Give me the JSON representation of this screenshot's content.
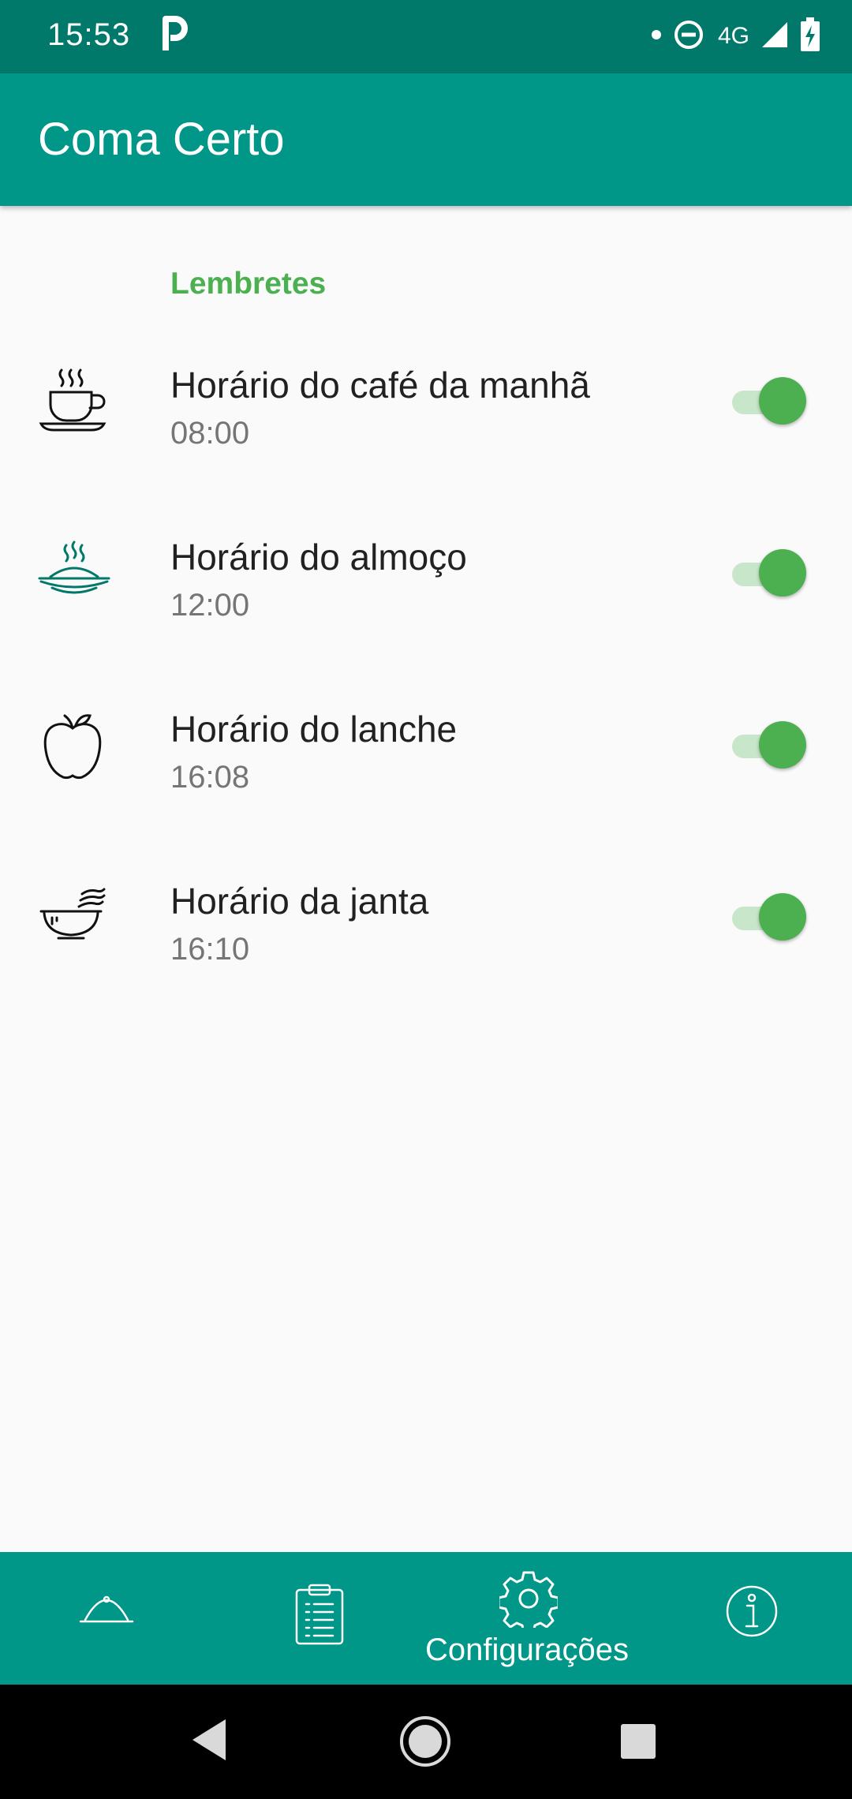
{
  "status_bar": {
    "time": "15:53",
    "network": "4G"
  },
  "app_bar": {
    "title": "Coma Certo"
  },
  "section": {
    "header": "Lembretes"
  },
  "reminders": [
    {
      "title": "Horário do café da manhã",
      "time": "08:00",
      "enabled": true,
      "icon": "coffee-cup-icon"
    },
    {
      "title": "Horário do almoço",
      "time": "12:00",
      "enabled": true,
      "icon": "hot-plate-icon"
    },
    {
      "title": "Horário do lanche",
      "time": "16:08",
      "enabled": true,
      "icon": "apple-icon"
    },
    {
      "title": "Horário da janta",
      "time": "16:10",
      "enabled": true,
      "icon": "bowl-icon"
    }
  ],
  "bottom_nav": {
    "items": [
      {
        "icon": "cloche-icon",
        "label": ""
      },
      {
        "icon": "clipboard-icon",
        "label": ""
      },
      {
        "icon": "gear-icon",
        "label": "Configurações",
        "active": true
      },
      {
        "icon": "info-icon",
        "label": ""
      }
    ]
  },
  "colors": {
    "status_bar": "#00796b",
    "primary": "#009688",
    "accent": "#4caf50",
    "background": "#fafafa"
  }
}
